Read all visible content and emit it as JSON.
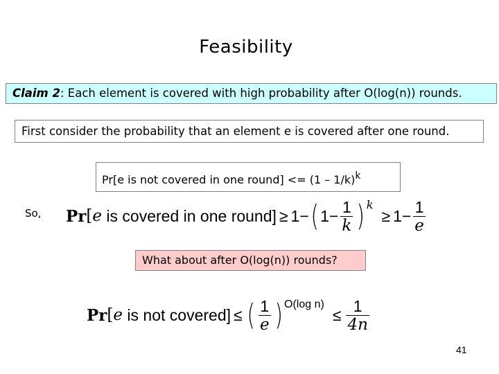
{
  "slide": {
    "title": "Feasibility",
    "claim": {
      "label": "Claim 2",
      "text": ": Each element is covered with high probability after O(log(n)) rounds.",
      "background": "#ccffff"
    },
    "first_consider": "First consider the probability that an element e is covered after one round.",
    "pr_statement": {
      "text": "Pr[e is not covered in one round] <= (1 – 1/k)",
      "exponent": "k"
    },
    "so_label": "So,",
    "equation_covered": {
      "pr": "Pr",
      "open_bracket": "[",
      "var_e": "e",
      "text": " is covered in one round]",
      "geq1": "≥",
      "one": "1−",
      "lparen": "(",
      "inner_one": "1−",
      "frac_num": "1",
      "frac_den": "k",
      "rparen": ")",
      "exponent": "k",
      "geq2": "≥",
      "one2": "1−",
      "frac2_num": "1",
      "frac2_den": "e"
    },
    "question": {
      "text": "What about after O(log(n)) rounds?",
      "background": "#ffcccc"
    },
    "equation_not_covered": {
      "pr": "Pr",
      "open_bracket": "[",
      "var_e": "e",
      "text": " is not covered]",
      "leq1": "≤",
      "lparen": "(",
      "frac_num": "1",
      "frac_den": "e",
      "rparen": ")",
      "exponent": "O(log n)",
      "leq2": "≤",
      "frac2_num": "1",
      "frac2_den": "4n"
    },
    "page_number": "41"
  }
}
